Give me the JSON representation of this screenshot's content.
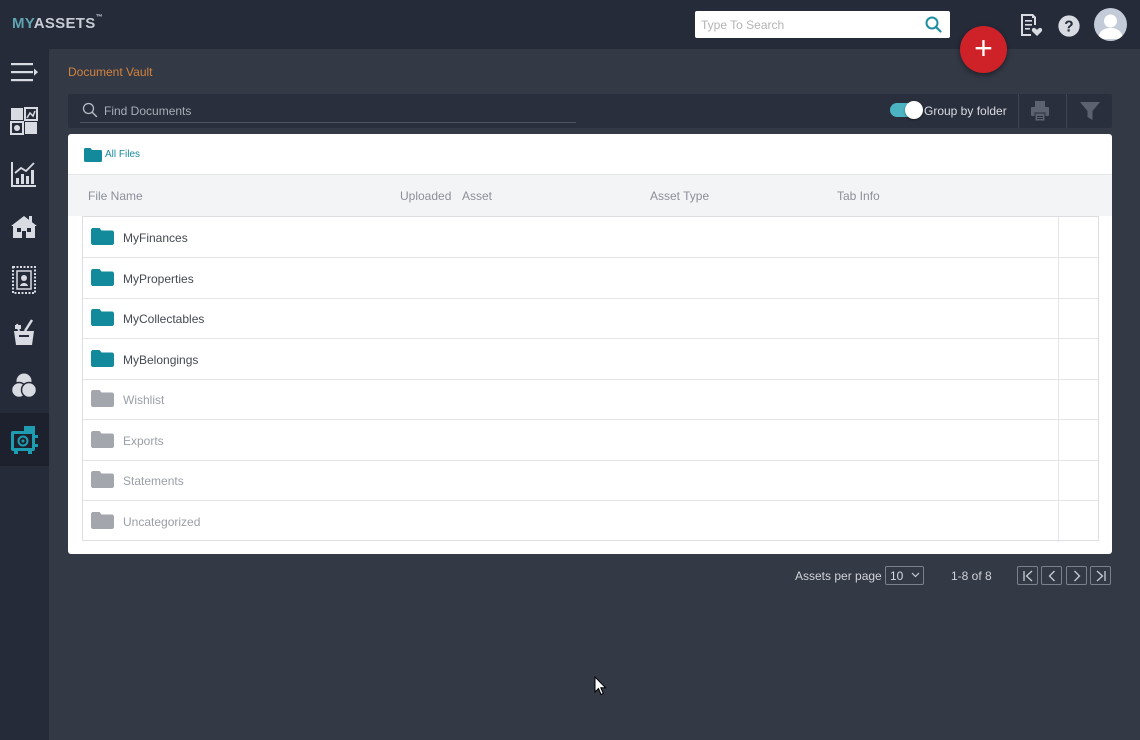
{
  "header": {
    "logo_prefix": "MY",
    "logo_main": "ASSETS",
    "logo_mark": "™",
    "search_placeholder": "Type To Search",
    "icons": [
      "search-icon",
      "document-heart-icon",
      "help-icon",
      "user-avatar-icon"
    ],
    "fab_label": "+"
  },
  "sidebar": {
    "items": [
      {
        "name": "menu-collapse-icon"
      },
      {
        "name": "dashboard-icon"
      },
      {
        "name": "finances-chart-icon"
      },
      {
        "name": "properties-house-icon"
      },
      {
        "name": "collectables-stamp-icon"
      },
      {
        "name": "belongings-icon"
      },
      {
        "name": "wishlist-circles-icon"
      },
      {
        "name": "document-vault-icon",
        "active": true
      }
    ]
  },
  "breadcrumb": "Document Vault",
  "toolbar": {
    "find_placeholder": "Find Documents",
    "group_label": "Group by folder",
    "group_enabled": true
  },
  "card": {
    "root_label": "All Files",
    "columns": [
      "File Name",
      "Uploaded",
      "Asset",
      "Asset Type",
      "Tab Info"
    ],
    "rows": [
      {
        "name": "MyFinances",
        "active": true
      },
      {
        "name": "MyProperties",
        "active": true
      },
      {
        "name": "MyCollectables",
        "active": true
      },
      {
        "name": "MyBelongings",
        "active": true
      },
      {
        "name": "Wishlist",
        "active": false
      },
      {
        "name": "Exports",
        "active": false
      },
      {
        "name": "Statements",
        "active": false
      },
      {
        "name": "Uncategorized",
        "active": false
      }
    ]
  },
  "pagination": {
    "per_page_label": "Assets per page",
    "per_page_value": "10",
    "range": "1-8 of 8"
  },
  "colors": {
    "accent": "#4cb3c2",
    "folder_teal": "#128a9c",
    "folder_gray": "#a3a6ad",
    "fab": "#cf2128",
    "breadcrumb": "#d2833d"
  }
}
